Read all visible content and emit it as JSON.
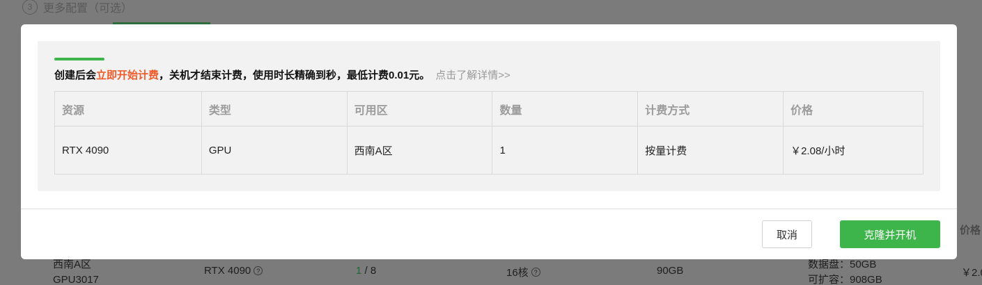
{
  "background": {
    "step_number": "3",
    "step_title": "更多配置（可选）",
    "price_header": "价格",
    "row": {
      "zone_line1": "西南A区",
      "zone_line2": "GPU3017",
      "gpu_model": "RTX 4090",
      "available": "1",
      "total": " / 8",
      "cpu": "16核",
      "memory": "90GB",
      "disk_line1": "数据盘：50GB",
      "disk_line2": "可扩容：908GB",
      "price": "￥2.0"
    }
  },
  "modal": {
    "notice": {
      "prefix": "创建后会",
      "highlight": "立即开始计费",
      "suffix": "，关机才结束计费，使用时长精确到秒，最低计费0.01元。",
      "link": "点击了解详情>>"
    },
    "table": {
      "headers": [
        "资源",
        "类型",
        "可用区",
        "数量",
        "计费方式",
        "价格"
      ],
      "rows": [
        [
          "RTX 4090",
          "GPU",
          "西南A区",
          "1",
          "按量计费",
          "￥2.08/小时"
        ]
      ]
    },
    "footer": {
      "cancel_label": "取消",
      "confirm_label": "克隆并开机"
    }
  },
  "colors": {
    "accent_green": "#3db54a",
    "highlight_orange": "#f05a28",
    "overlay": "#7b7b7b"
  }
}
